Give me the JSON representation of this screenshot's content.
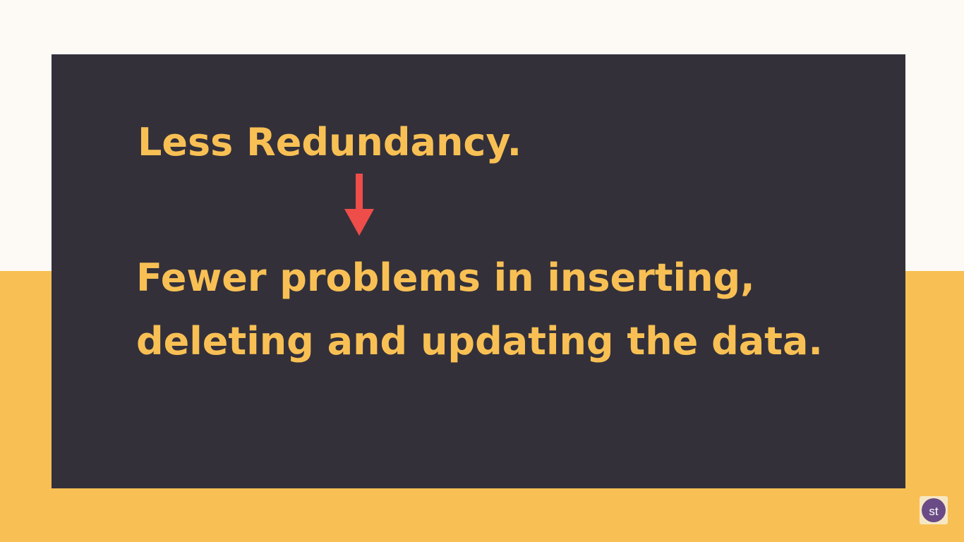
{
  "slide": {
    "headline": "Less Redundancy.",
    "body": "Fewer problems in inserting, deleting and updating the data.",
    "arrow_icon": "down-arrow-icon"
  },
  "logo": {
    "text": "st"
  },
  "colors": {
    "top_background": "#fdfaf5",
    "bottom_background": "#f8c054",
    "card_background": "#33303a",
    "text": "#f8c054",
    "arrow": "#ee4d4a",
    "logo_circle": "#6a4b86",
    "logo_badge": "#f6e7c4"
  }
}
